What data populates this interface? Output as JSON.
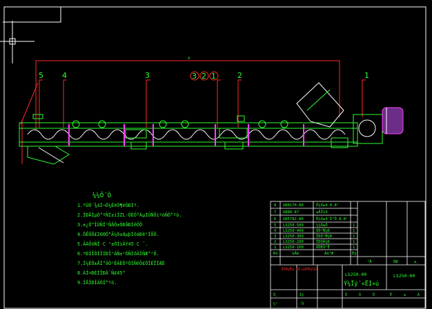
{
  "colors": {
    "background": "#000000",
    "frame": "#ffffff",
    "outline": "#ff2a2a",
    "geometry": "#2fff2f",
    "leader": "#ffffff",
    "accent": "#ff40ff"
  },
  "crosshair": {
    "name": "ucs-crosshair-icon"
  },
  "balloons": [
    "5",
    "4",
    "3",
    "3",
    "2",
    "1",
    "2",
    "1"
  ],
  "notes": {
    "title": "¼¼Ö´Ò",
    "lines": [
      "1.ºÜÓ¨¾àÍ¬Ò¼ÉëÒ¶ëÓÐÍº.",
      "2.ÏÐÅÌµÓ°ºÑÍ±íÍZL-ÖÈÕ°ÁµÍÛÑÖíºòÑÖ°ºò.",
      "3.±¿Ó°ÎÜÑÍ¹ÑåÕ±ÓÐåÐÍêÖÕ",
      "4.ÖÊÕÖ£200Ó°Ã¼ð±ãµþÍõáÐê²ÍÕÕ.",
      "5.ÃÀÕöÑÎ C ¹±ÓÍìÃÝ45 C ¯.",
      "6.ºÐÍÎÒÍÏÍÐÏ²ÀÑ±¹ÒÑÍõÂÏÑÆ°²Õ.",
      "7.Ì¼ÉÓ±ÅÍ°ãÒ²ÉÁÈÓºÒÍÑêÕ£ÓÍÉÎÍÆÈ",
      "8.ÀÍ=ÐÈÏÎÐÄ¯Ñ£45°",
      "9.ÍÅÏÐÍÄÓÍ°ºò."
    ]
  },
  "bom": {
    "rows": [
      {
        "no": "8",
        "code": "GB8170-88",
        "name": "Ö¼Ó±4 8.8¹",
        "qty": ""
      },
      {
        "no": "7",
        "code": "GB88-87",
        "name": "±ÅÏ14",
        "qty": ""
      },
      {
        "no": "6",
        "code": "GB5782-86",
        "name": "Ö¼Ó±4¯Ò³Ö 8.8¹",
        "qty": ""
      },
      {
        "no": "5",
        "code": "LS250-500",
        "name": "¼¼Ò±Ô",
        "qty": "1"
      },
      {
        "no": "4",
        "code": "LS250-400",
        "name": "ÓÒ¹Ñ¼Ð",
        "qty": "1"
      },
      {
        "no": "3",
        "code": "LS250-300",
        "name": "ÌÐÒ¹Ñ¼Ð",
        "qty": "1"
      },
      {
        "no": "2",
        "code": "LS250-200",
        "name": "ÌÐÒÀ¼Ð",
        "qty": "1"
      },
      {
        "no": "1",
        "code": "LS250-100",
        "name": "ÖÖËÓ²Ê",
        "qty": "1"
      }
    ],
    "header": {
      "no": "Ðò",
      "code": "´úÂë",
      "name": "Ãû³Æ",
      "qty": "Êý",
      "material": "²Ä",
      "weight": "ÖØ",
      "note": "±¸"
    }
  },
  "title_block": {
    "drawing_no_left": "LS250-00",
    "drawing_name": "Ý¼Ïý´«ËÍ»ú",
    "drawing_no_right": "LS250-00",
    "red_label": "ÂÝÐýÊä ËÍ»úÂÝÐý¼Ü",
    "scale_row": [
      "Ô",
      "Ò",
      "Ô",
      "Ë",
      "±",
      "Ã"
    ],
    "bottom_labels": [
      "Ô¸",
      "Íý",
      "¼¹",
      "´Ö"
    ]
  }
}
